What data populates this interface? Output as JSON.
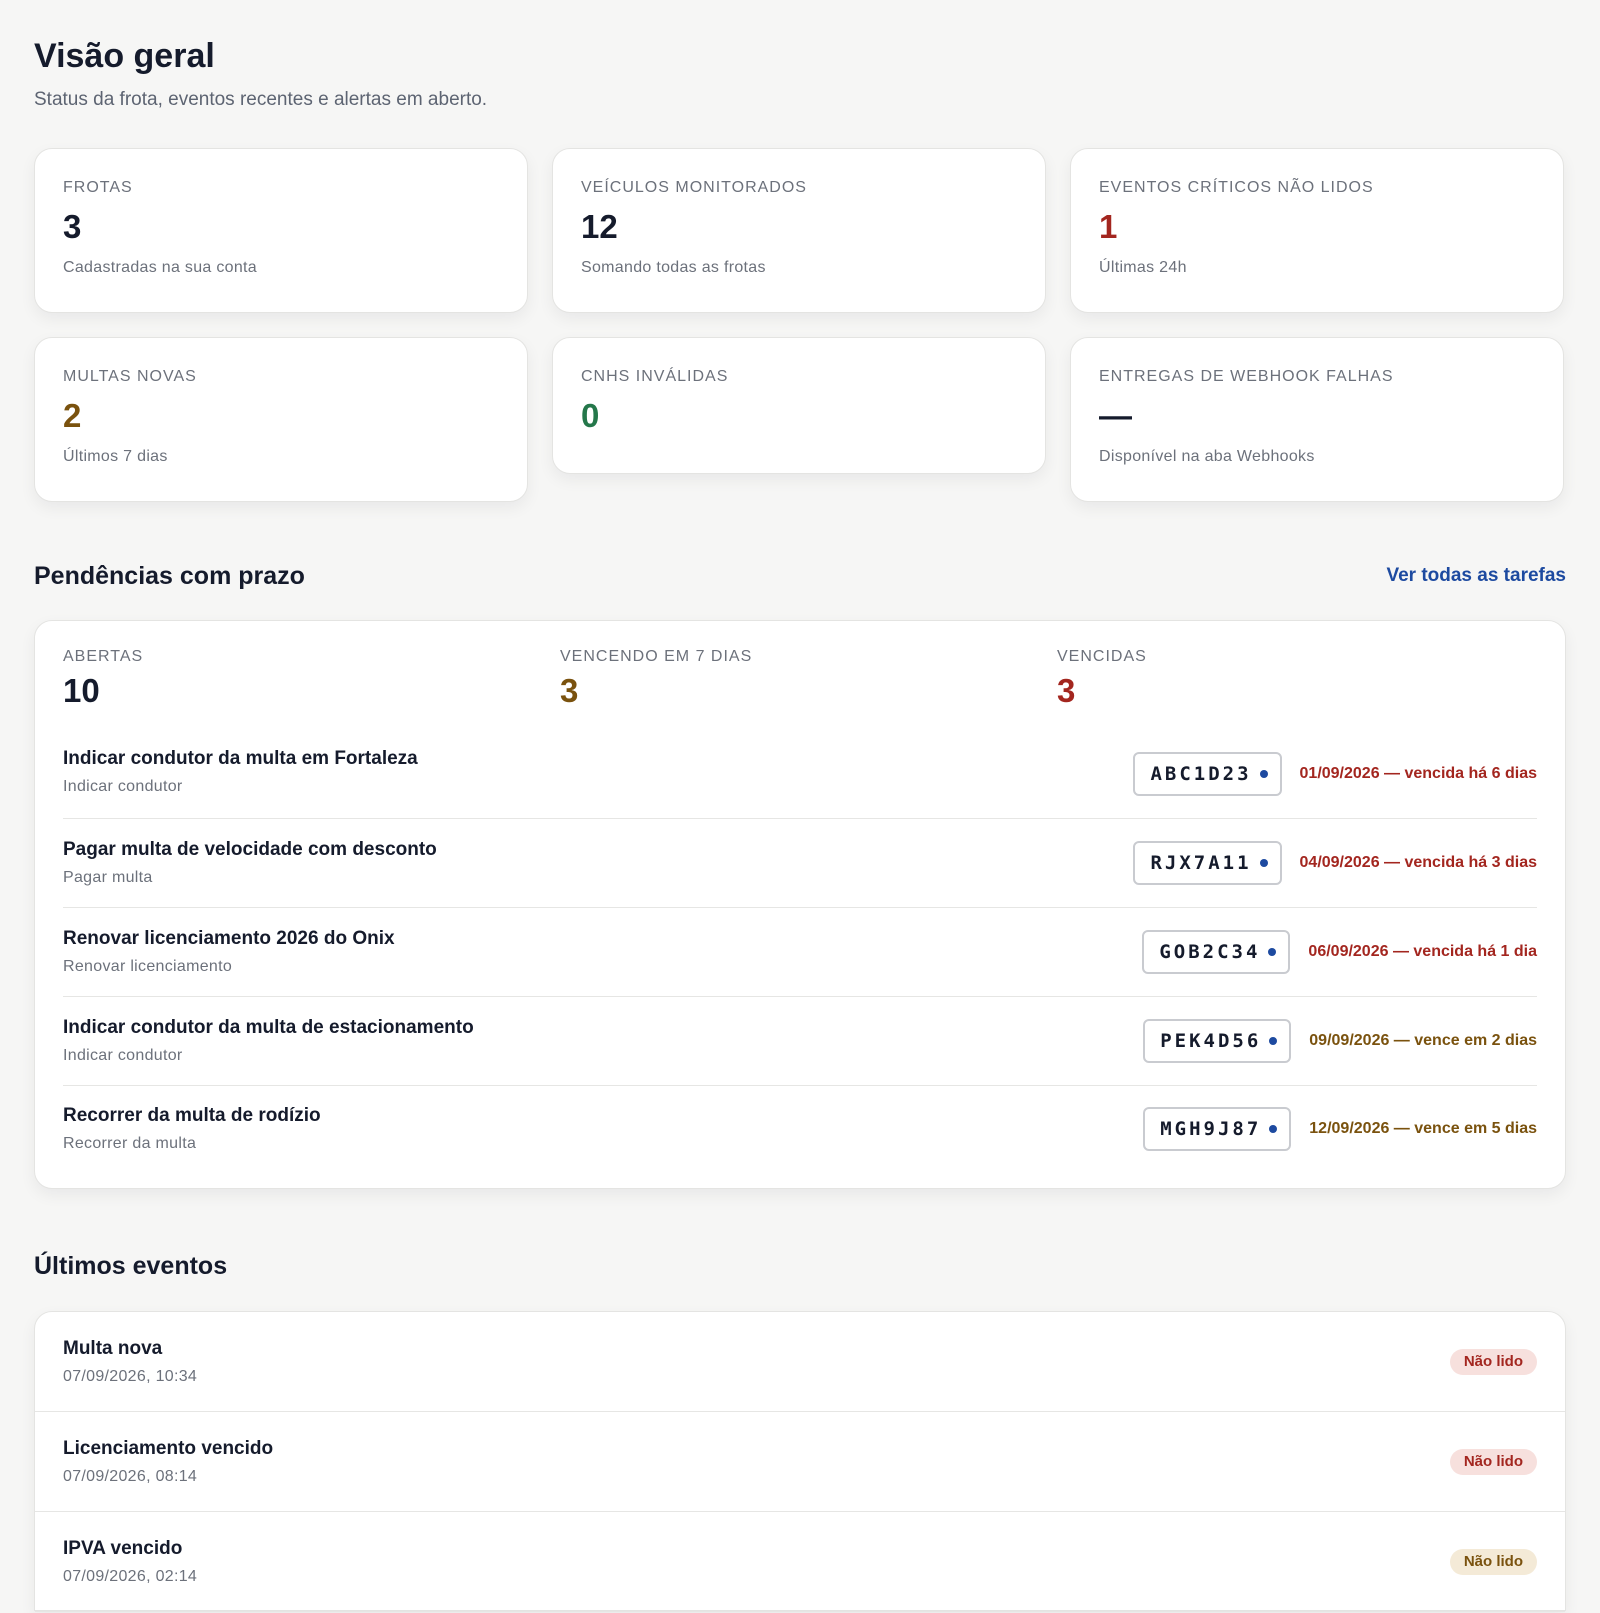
{
  "header": {
    "title": "Visão geral",
    "subtitle": "Status da frota, eventos recentes e alertas em aberto."
  },
  "stats": [
    {
      "label": "FROTAS",
      "value": "3",
      "note": "Cadastradas na sua conta",
      "color": "#151b2c"
    },
    {
      "label": "VEÍCULOS MONITORADOS",
      "value": "12",
      "note": "Somando todas as frotas",
      "color": "#151b2c"
    },
    {
      "label": "EVENTOS CRÍTICOS NÃO LIDOS",
      "value": "1",
      "note": "Últimas 24h",
      "color": "#a3261f"
    },
    {
      "label": "MULTAS NOVAS",
      "value": "2",
      "note": "Últimos 7 dias",
      "color": "#7a520e"
    },
    {
      "label": "CNHS INVÁLIDAS",
      "value": "0",
      "note": "",
      "color": "#24774a"
    },
    {
      "label": "ENTREGAS DE WEBHOOK FALHAS",
      "value": "—",
      "note": "Disponível na aba Webhooks",
      "color": "#151b2c"
    }
  ],
  "tasks": {
    "section_title": "Pendências com prazo",
    "view_all_link": "Ver todas as tarefas",
    "summary": [
      {
        "label": "ABERTAS",
        "value": "10",
        "color": "#151b2c"
      },
      {
        "label": "VENCENDO EM 7 DIAS",
        "value": "3",
        "color": "#7a520e"
      },
      {
        "label": "VENCIDAS",
        "value": "3",
        "color": "#a3261f"
      }
    ],
    "items": [
      {
        "title": "Indicar condutor da multa em Fortaleza",
        "type": "Indicar condutor",
        "plate": "ABC1D23",
        "due": "01/09/2026 — vencida há 6 dias",
        "status": "overdue"
      },
      {
        "title": "Pagar multa de velocidade com desconto",
        "type": "Pagar multa",
        "plate": "RJX7A11",
        "due": "04/09/2026 — vencida há 3 dias",
        "status": "overdue"
      },
      {
        "title": "Renovar licenciamento 2026 do Onix",
        "type": "Renovar licenciamento",
        "plate": "GOB2C34",
        "due": "06/09/2026 — vencida há 1 dia",
        "status": "overdue"
      },
      {
        "title": "Indicar condutor da multa de estacionamento",
        "type": "Indicar condutor",
        "plate": "PEK4D56",
        "due": "09/09/2026 — vence em 2 dias",
        "status": "soon"
      },
      {
        "title": "Recorrer da multa de rodízio",
        "type": "Recorrer da multa",
        "plate": "MGH9J87",
        "due": "12/09/2026 — vence em 5 dias",
        "status": "soon"
      }
    ]
  },
  "events": {
    "section_title": "Últimos eventos",
    "items": [
      {
        "title": "Multa nova",
        "time": "07/09/2026, 10:34",
        "badge": "Não lido",
        "severity": "critical"
      },
      {
        "title": "Licenciamento vencido",
        "time": "07/09/2026, 08:14",
        "badge": "Não lido",
        "severity": "critical"
      },
      {
        "title": "IPVA vencido",
        "time": "07/09/2026, 02:14",
        "badge": "Não lido",
        "severity": "warning"
      }
    ]
  }
}
